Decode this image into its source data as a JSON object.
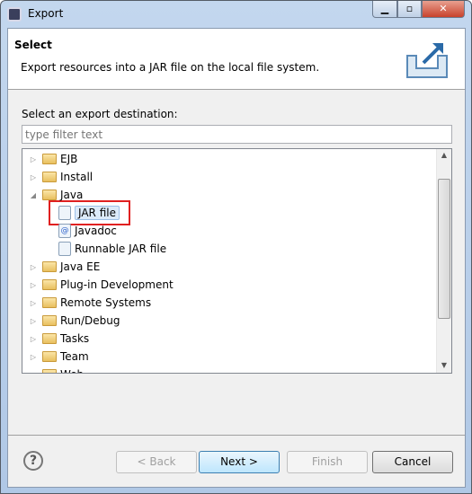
{
  "window": {
    "title": "Export",
    "icon": "eclipse-icon"
  },
  "header": {
    "title": "Select",
    "description": "Export resources into a JAR file on the local file system.",
    "icon": "export-icon"
  },
  "destination_label": "Select an export destination:",
  "filter": {
    "value": "",
    "placeholder": "type filter text"
  },
  "tree": [
    {
      "label": "EJB",
      "type": "folder",
      "expanded": false,
      "level": 0
    },
    {
      "label": "Install",
      "type": "folder",
      "expanded": false,
      "level": 0
    },
    {
      "label": "Java",
      "type": "folder",
      "expanded": true,
      "level": 0
    },
    {
      "label": "JAR file",
      "type": "jar",
      "level": 1,
      "selected": true
    },
    {
      "label": "Javadoc",
      "type": "javadoc",
      "level": 1
    },
    {
      "label": "Runnable JAR file",
      "type": "runnable-jar",
      "level": 1
    },
    {
      "label": "Java EE",
      "type": "folder",
      "expanded": false,
      "level": 0
    },
    {
      "label": "Plug-in Development",
      "type": "folder",
      "expanded": false,
      "level": 0
    },
    {
      "label": "Remote Systems",
      "type": "folder",
      "expanded": false,
      "level": 0
    },
    {
      "label": "Run/Debug",
      "type": "folder",
      "expanded": false,
      "level": 0
    },
    {
      "label": "Tasks",
      "type": "folder",
      "expanded": false,
      "level": 0
    },
    {
      "label": "Team",
      "type": "folder",
      "expanded": false,
      "level": 0
    },
    {
      "label": "Web",
      "type": "folder",
      "expanded": false,
      "level": 0
    }
  ],
  "buttons": {
    "back": "< Back",
    "next": "Next >",
    "finish": "Finish",
    "cancel": "Cancel"
  },
  "highlight_color": "#e02020"
}
